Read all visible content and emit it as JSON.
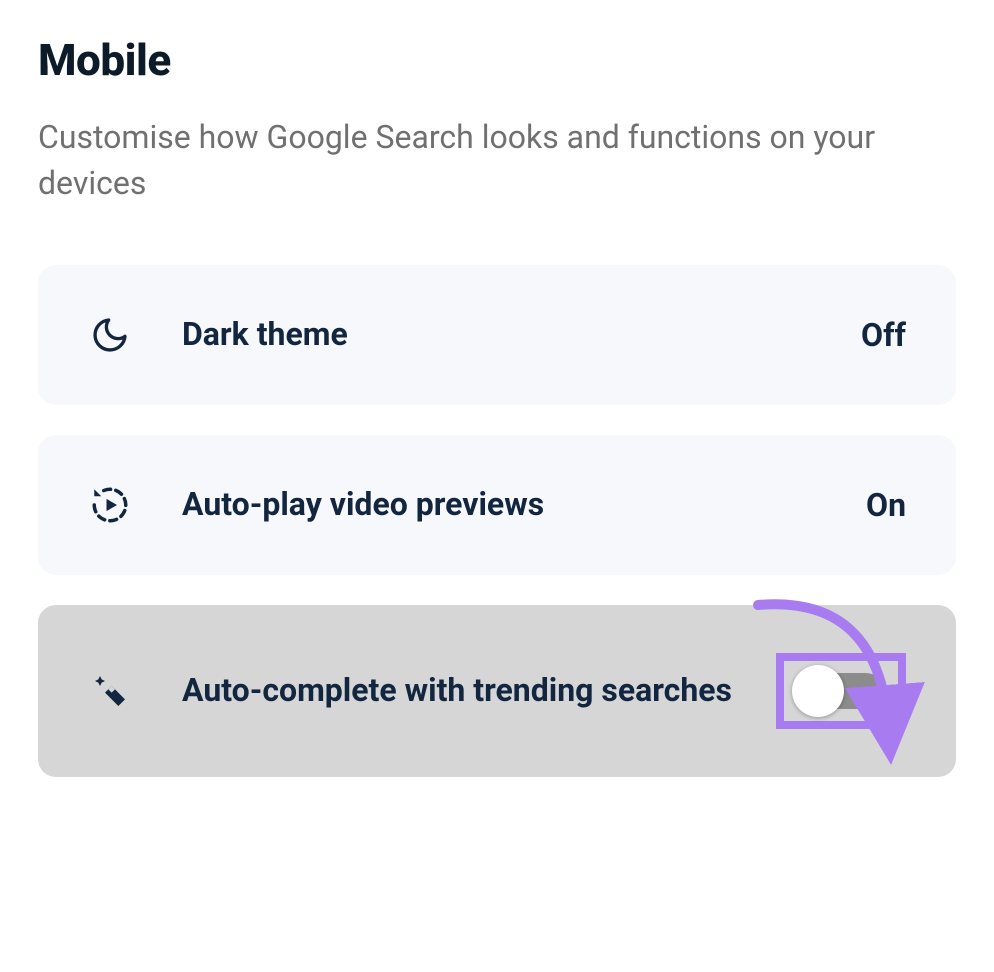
{
  "header": {
    "title": "Mobile",
    "subtitle": "Customise how Google Search looks and functions on your devices"
  },
  "settings": [
    {
      "icon": "moon-icon",
      "label": "Dark theme",
      "value": "Off",
      "control": "text"
    },
    {
      "icon": "replay-play-icon",
      "label": "Auto-play video previews",
      "value": "On",
      "control": "text"
    },
    {
      "icon": "magic-wand-icon",
      "label": "Auto-complete with trending searches",
      "value": "off",
      "control": "toggle",
      "highlighted": true
    }
  ],
  "annotation": {
    "color": "#a97bf0"
  }
}
